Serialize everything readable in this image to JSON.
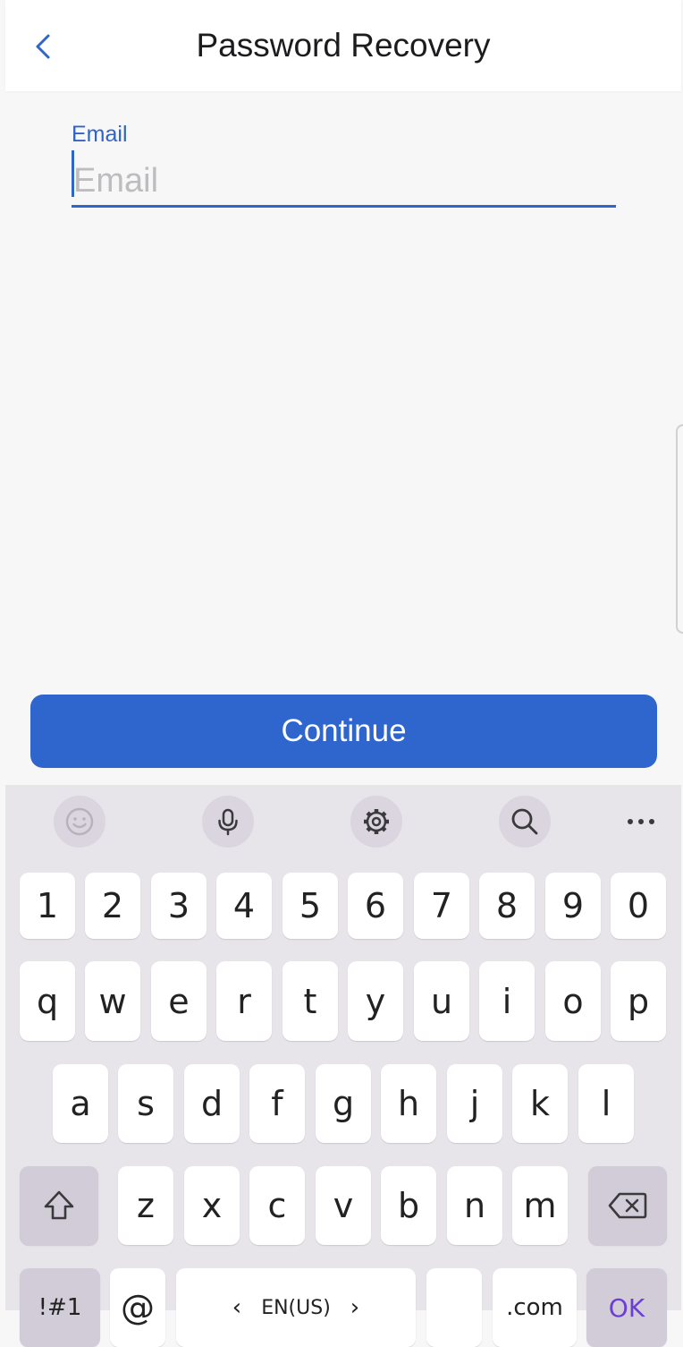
{
  "header": {
    "title": "Password Recovery",
    "back_icon": "chevron-left-icon",
    "accent": "#2f66cd"
  },
  "form": {
    "email_label": "Email",
    "email_placeholder": "Email",
    "email_value": ""
  },
  "continue_label": "Continue",
  "keyboard": {
    "toolbar": [
      "emoji-icon",
      "microphone-icon",
      "gear-icon",
      "search-icon",
      "more-icon"
    ],
    "row_numbers": [
      "1",
      "2",
      "3",
      "4",
      "5",
      "6",
      "7",
      "8",
      "9",
      "0"
    ],
    "row_q": [
      "q",
      "w",
      "e",
      "r",
      "t",
      "y",
      "u",
      "i",
      "o",
      "p"
    ],
    "row_a": [
      "a",
      "s",
      "d",
      "f",
      "g",
      "h",
      "j",
      "k",
      "l"
    ],
    "row_z": [
      "z",
      "x",
      "c",
      "v",
      "b",
      "n",
      "m"
    ],
    "bottom": {
      "symbols": "!#1",
      "at": "@",
      "language": "EN(US)",
      "dotcom": ".com",
      "ok": "OK"
    }
  }
}
